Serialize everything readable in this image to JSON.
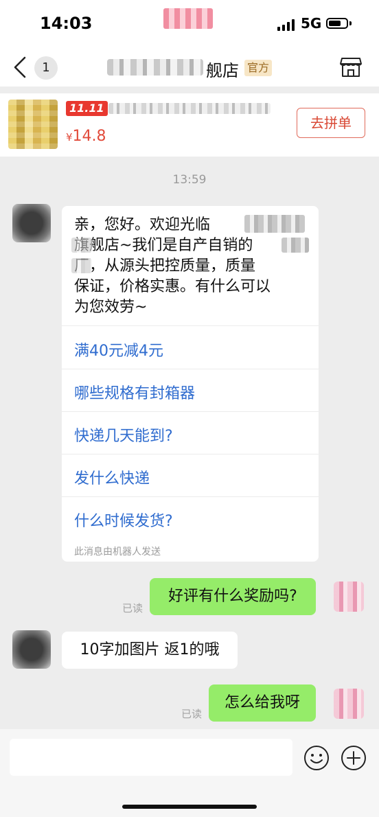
{
  "status_bar": {
    "time": "14:03",
    "network": "5G"
  },
  "nav": {
    "unread_count": "1",
    "shop_name_suffix": "舰店",
    "official_badge": "官方"
  },
  "product": {
    "promo_tag": "11.11",
    "price_symbol": "¥",
    "price": "14.8",
    "action_button": "去拼单"
  },
  "chat": {
    "timestamp": "13:59",
    "welcome_lines": [
      "亲，您好。欢迎光临",
      "旗舰店~我们是自产自销的",
      "厂，从源头把控质量，质量",
      "保证，价格实惠。有什么可以",
      "为您效劳~"
    ],
    "quick_questions": [
      "满40元减4元",
      "哪些规格有封箱器",
      "快递几天能到?",
      "发什么快递",
      "什么时候发货?"
    ],
    "robot_note": "此消息由机器人发送",
    "messages": [
      {
        "from": "me",
        "text": "好评有什么奖励吗?",
        "status": "已读"
      },
      {
        "from": "shop",
        "text": "10字加图片 返1的哦"
      },
      {
        "from": "me",
        "text": "怎么给我呀",
        "status": "已读"
      }
    ]
  },
  "icons": [
    "back-chevron-icon",
    "store-icon",
    "emoji-icon",
    "plus-icon"
  ],
  "colors": {
    "my_bubble": "#95ec69",
    "link_blue": "#2f6ccf",
    "price_red": "#e24b3b",
    "promo_red": "#e8382f"
  }
}
